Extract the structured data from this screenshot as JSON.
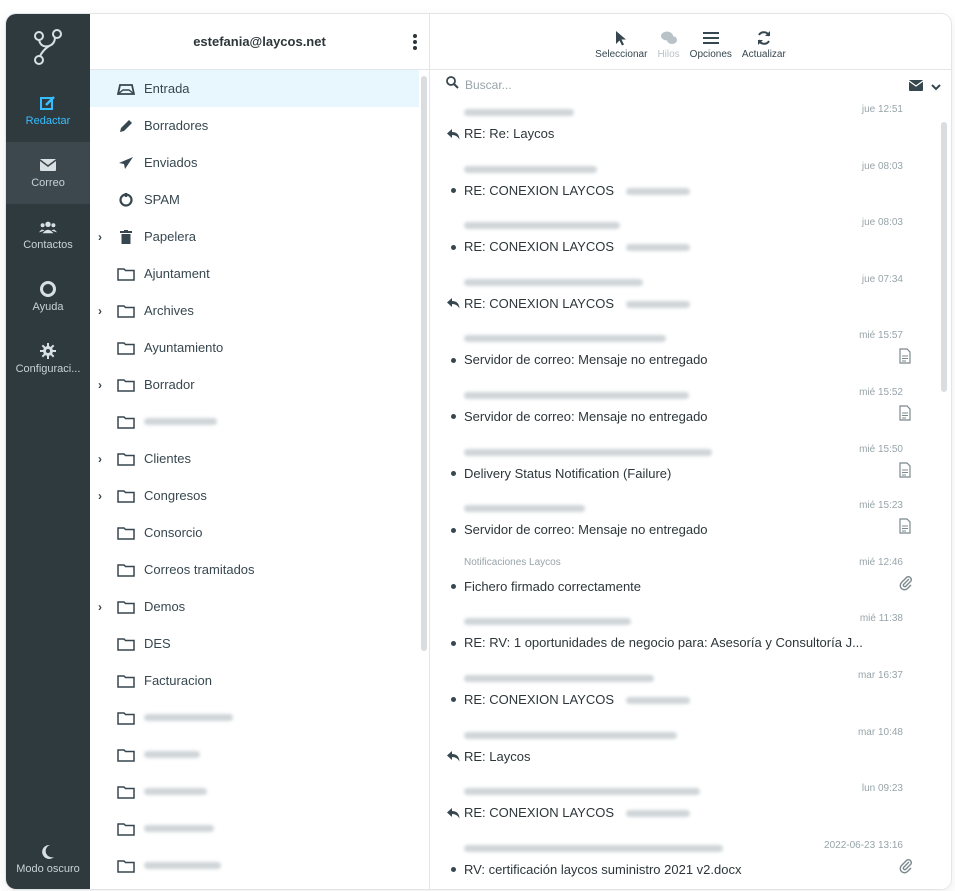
{
  "nav": {
    "items": [
      {
        "label": "Redactar"
      },
      {
        "label": "Correo"
      },
      {
        "label": "Contactos"
      },
      {
        "label": "Ayuda"
      },
      {
        "label": "Configuraci..."
      }
    ],
    "dark_mode_label": "Modo oscuro"
  },
  "account": "estefania@laycos.net",
  "folders": [
    {
      "label": "Entrada",
      "icon": "inbox-icon",
      "selected": true,
      "expandable": false
    },
    {
      "label": "Borradores",
      "icon": "pencil-icon",
      "expandable": false
    },
    {
      "label": "Enviados",
      "icon": "paper-plane-icon",
      "expandable": false
    },
    {
      "label": "SPAM",
      "icon": "spam-icon",
      "expandable": false
    },
    {
      "label": "Papelera",
      "icon": "trash-icon",
      "expandable": true
    },
    {
      "label": "Ajuntament",
      "icon": "folder-icon",
      "expandable": false
    },
    {
      "label": "Archives",
      "icon": "folder-icon",
      "expandable": true
    },
    {
      "label": "Ayuntamiento",
      "icon": "folder-icon",
      "expandable": false
    },
    {
      "label": "Borrador",
      "icon": "folder-icon",
      "expandable": true
    },
    {
      "label": "",
      "icon": "folder-icon",
      "expandable": false,
      "blurred": true
    },
    {
      "label": "Clientes",
      "icon": "folder-icon",
      "expandable": true
    },
    {
      "label": "Congresos",
      "icon": "folder-icon",
      "expandable": true
    },
    {
      "label": "Consorcio",
      "icon": "folder-icon",
      "expandable": false
    },
    {
      "label": "Correos tramitados",
      "icon": "folder-icon",
      "expandable": false
    },
    {
      "label": "Demos",
      "icon": "folder-icon",
      "expandable": true
    },
    {
      "label": "DES",
      "icon": "folder-icon",
      "expandable": false
    },
    {
      "label": "Facturacion",
      "icon": "folder-icon",
      "expandable": false
    },
    {
      "label": "",
      "icon": "folder-icon",
      "expandable": false,
      "blurred": true
    },
    {
      "label": "",
      "icon": "folder-icon",
      "expandable": false,
      "blurred": true
    },
    {
      "label": "",
      "icon": "folder-icon",
      "expandable": false,
      "blurred": true
    },
    {
      "label": "",
      "icon": "folder-icon",
      "expandable": false,
      "blurred": true
    },
    {
      "label": "",
      "icon": "folder-icon",
      "expandable": false,
      "blurred": true
    }
  ],
  "toolbar": {
    "select_label": "Seleccionar",
    "threads_label": "Hilos",
    "options_label": "Opciones",
    "refresh_label": "Actualizar"
  },
  "search": {
    "placeholder": "Buscar..."
  },
  "messages": [
    {
      "from": "",
      "date": "jue 12:51",
      "subject": "RE: Re: Laycos",
      "status": "replied",
      "attachment": false
    },
    {
      "from": "",
      "date": "jue 08:03",
      "subject": "RE: CONEXION LAYCOS",
      "status": "unread",
      "attachment": false
    },
    {
      "from": "",
      "date": "jue 08:03",
      "subject": "RE: CONEXION LAYCOS",
      "status": "unread",
      "attachment": false
    },
    {
      "from": "",
      "date": "jue 07:34",
      "subject": "RE: CONEXION LAYCOS",
      "status": "replied",
      "attachment": false
    },
    {
      "from": "",
      "date": "mié 15:57",
      "subject": "Servidor de correo: Mensaje no entregado",
      "status": "unread",
      "attachment": "report"
    },
    {
      "from": "",
      "date": "mié 15:52",
      "subject": "Servidor de correo: Mensaje no entregado",
      "status": "unread",
      "attachment": "report"
    },
    {
      "from": "",
      "date": "mié 15:50",
      "subject": "Delivery Status Notification (Failure)",
      "status": "unread",
      "attachment": "report"
    },
    {
      "from": "",
      "date": "mié 15:23",
      "subject": "Servidor de correo: Mensaje no entregado",
      "status": "unread",
      "attachment": "report"
    },
    {
      "from": "Notificaciones Laycos",
      "date": "mié 12:46",
      "subject": "Fichero firmado correctamente",
      "status": "unread",
      "attachment": "clip"
    },
    {
      "from": "",
      "date": "mié 11:38",
      "subject": "RE: RV: 1 oportunidades de negocio para: Asesoría y Consultoría J...",
      "status": "unread",
      "attachment": false
    },
    {
      "from": "",
      "date": "mar 16:37",
      "subject": "RE: CONEXION LAYCOS",
      "status": "unread",
      "attachment": false
    },
    {
      "from": "",
      "date": "mar 10:48",
      "subject": "RE: Laycos",
      "status": "replied",
      "attachment": false
    },
    {
      "from": "",
      "date": "lun 09:23",
      "subject": "RE: CONEXION LAYCOS",
      "status": "replied",
      "attachment": false
    },
    {
      "from": "",
      "date": "2022-06-23 13:16",
      "subject": "RV: certificación laycos suministro 2021 v2.docx",
      "status": "unread",
      "attachment": "clip"
    }
  ]
}
